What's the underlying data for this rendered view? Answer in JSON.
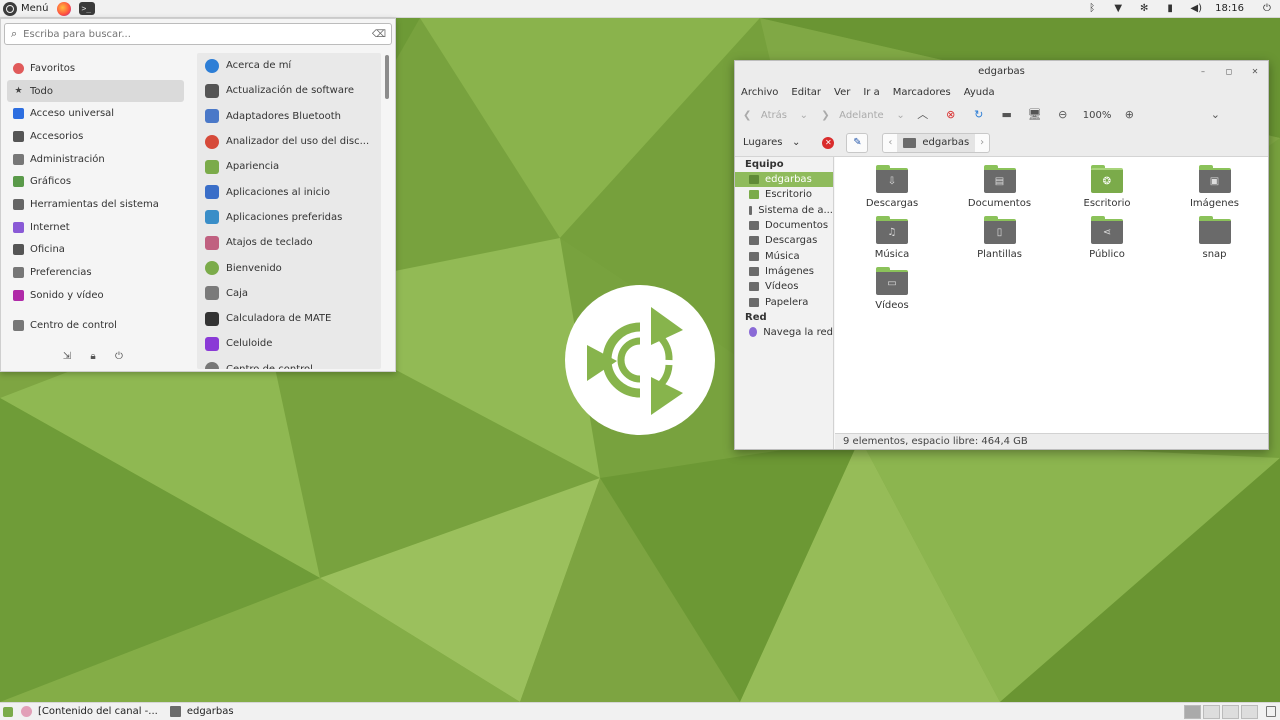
{
  "top_panel": {
    "menu_label": "Menú",
    "clock": "18:16",
    "tray_icons": [
      "bluetooth-icon",
      "wifi-icon",
      "settings-icon",
      "battery-icon",
      "volume-icon",
      "power-icon"
    ]
  },
  "app_menu": {
    "search_placeholder": "Escriba para buscar...",
    "categories": [
      {
        "label": "Favoritos",
        "icon": "heart-icon",
        "color": "#e05a5a"
      },
      {
        "label": "Todo",
        "icon": "star-icon",
        "color": "#444444"
      },
      {
        "label": "Acceso universal",
        "icon": "accessibility-icon",
        "color": "#2d6ee0"
      },
      {
        "label": "Accesorios",
        "icon": "accessories-icon",
        "color": "#555555"
      },
      {
        "label": "Administración",
        "icon": "administration-icon",
        "color": "#777777"
      },
      {
        "label": "Gráficos",
        "icon": "graphics-icon",
        "color": "#5a9a4a"
      },
      {
        "label": "Herramientas del sistema",
        "icon": "system-tools-icon",
        "color": "#666666"
      },
      {
        "label": "Internet",
        "icon": "internet-icon",
        "color": "#8a5ad6"
      },
      {
        "label": "Oficina",
        "icon": "office-icon",
        "color": "#555555"
      },
      {
        "label": "Preferencias",
        "icon": "preferences-icon",
        "color": "#777777"
      },
      {
        "label": "Sonido y vídeo",
        "icon": "media-icon",
        "color": "#b02aa8"
      },
      {
        "label": "Centro de control",
        "icon": "control-center-icon",
        "color": "#777777"
      }
    ],
    "selected_category": "Todo",
    "apps": [
      {
        "label": "Acerca de mí",
        "color": "#2d7ed6"
      },
      {
        "label": "Actualización de software",
        "color": "#555555"
      },
      {
        "label": "Adaptadores Bluetooth",
        "color": "#4a78c8"
      },
      {
        "label": "Analizador del uso del disc...",
        "color": "#d64a3a"
      },
      {
        "label": "Apariencia",
        "color": "#7bab4a"
      },
      {
        "label": "Aplicaciones al inicio",
        "color": "#3a6ec8"
      },
      {
        "label": "Aplicaciones preferidas",
        "color": "#3a8ec8"
      },
      {
        "label": "Atajos de teclado",
        "color": "#c06080"
      },
      {
        "label": "Bienvenido",
        "color": "#7bab4a"
      },
      {
        "label": "Caja",
        "color": "#7a7a7a"
      },
      {
        "label": "Calculadora de MATE",
        "color": "#333333"
      },
      {
        "label": "Celuloide",
        "color": "#8a3ad6"
      },
      {
        "label": "Centro de control",
        "color": "#777777"
      }
    ]
  },
  "file_manager": {
    "title": "edgarbas",
    "menubar": [
      "Archivo",
      "Editar",
      "Ver",
      "Ir a",
      "Marcadores",
      "Ayuda"
    ],
    "toolbar": {
      "back": "Atrás",
      "forward": "Adelante",
      "zoom": "100%"
    },
    "places_label": "Lugares",
    "breadcrumb": "edgarbas",
    "sidebar": {
      "equipo_header": "Equipo",
      "equipo": [
        {
          "label": "edgarbas",
          "selected": true
        },
        {
          "label": "Escritorio"
        },
        {
          "label": "Sistema de a..."
        },
        {
          "label": "Documentos"
        },
        {
          "label": "Descargas"
        },
        {
          "label": "Música"
        },
        {
          "label": "Imágenes"
        },
        {
          "label": "Vídeos"
        },
        {
          "label": "Papelera"
        }
      ],
      "red_header": "Red",
      "red": [
        {
          "label": "Navega la red"
        }
      ]
    },
    "items": [
      {
        "label": "Descargas",
        "icon": "download-icon",
        "glyph": "⇩"
      },
      {
        "label": "Documentos",
        "icon": "document-icon",
        "glyph": "▤"
      },
      {
        "label": "Escritorio",
        "icon": "desktop-folder-icon",
        "glyph": "❂",
        "green": true
      },
      {
        "label": "Imágenes",
        "icon": "image-icon",
        "glyph": "▣"
      },
      {
        "label": "Música",
        "icon": "music-icon",
        "glyph": "♫"
      },
      {
        "label": "Plantillas",
        "icon": "template-icon",
        "glyph": "▯"
      },
      {
        "label": "Público",
        "icon": "share-icon",
        "glyph": "⋖"
      },
      {
        "label": "snap",
        "icon": "folder-icon",
        "glyph": ""
      },
      {
        "label": "Vídeos",
        "icon": "video-icon",
        "glyph": "▭"
      }
    ],
    "status": "9 elementos, espacio libre: 464,4 GB"
  },
  "bottom_panel": {
    "tasks": [
      {
        "label": "[Contenido del canal -..."
      },
      {
        "label": "edgarbas"
      }
    ]
  }
}
